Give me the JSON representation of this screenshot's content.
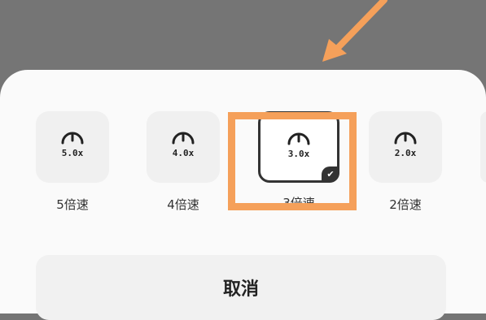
{
  "speed_sheet": {
    "options": [
      {
        "icon_text": "5.0x",
        "label": "5倍速",
        "selected": false
      },
      {
        "icon_text": "4.0x",
        "label": "4倍速",
        "selected": false
      },
      {
        "icon_text": "3.0x",
        "label": "3倍速",
        "selected": true
      },
      {
        "icon_text": "2.0x",
        "label": "2倍速",
        "selected": false
      }
    ],
    "cancel_label": "取消"
  },
  "annotation": {
    "highlight_color": "#f5a05a",
    "arrow_color": "#f5a05a"
  }
}
